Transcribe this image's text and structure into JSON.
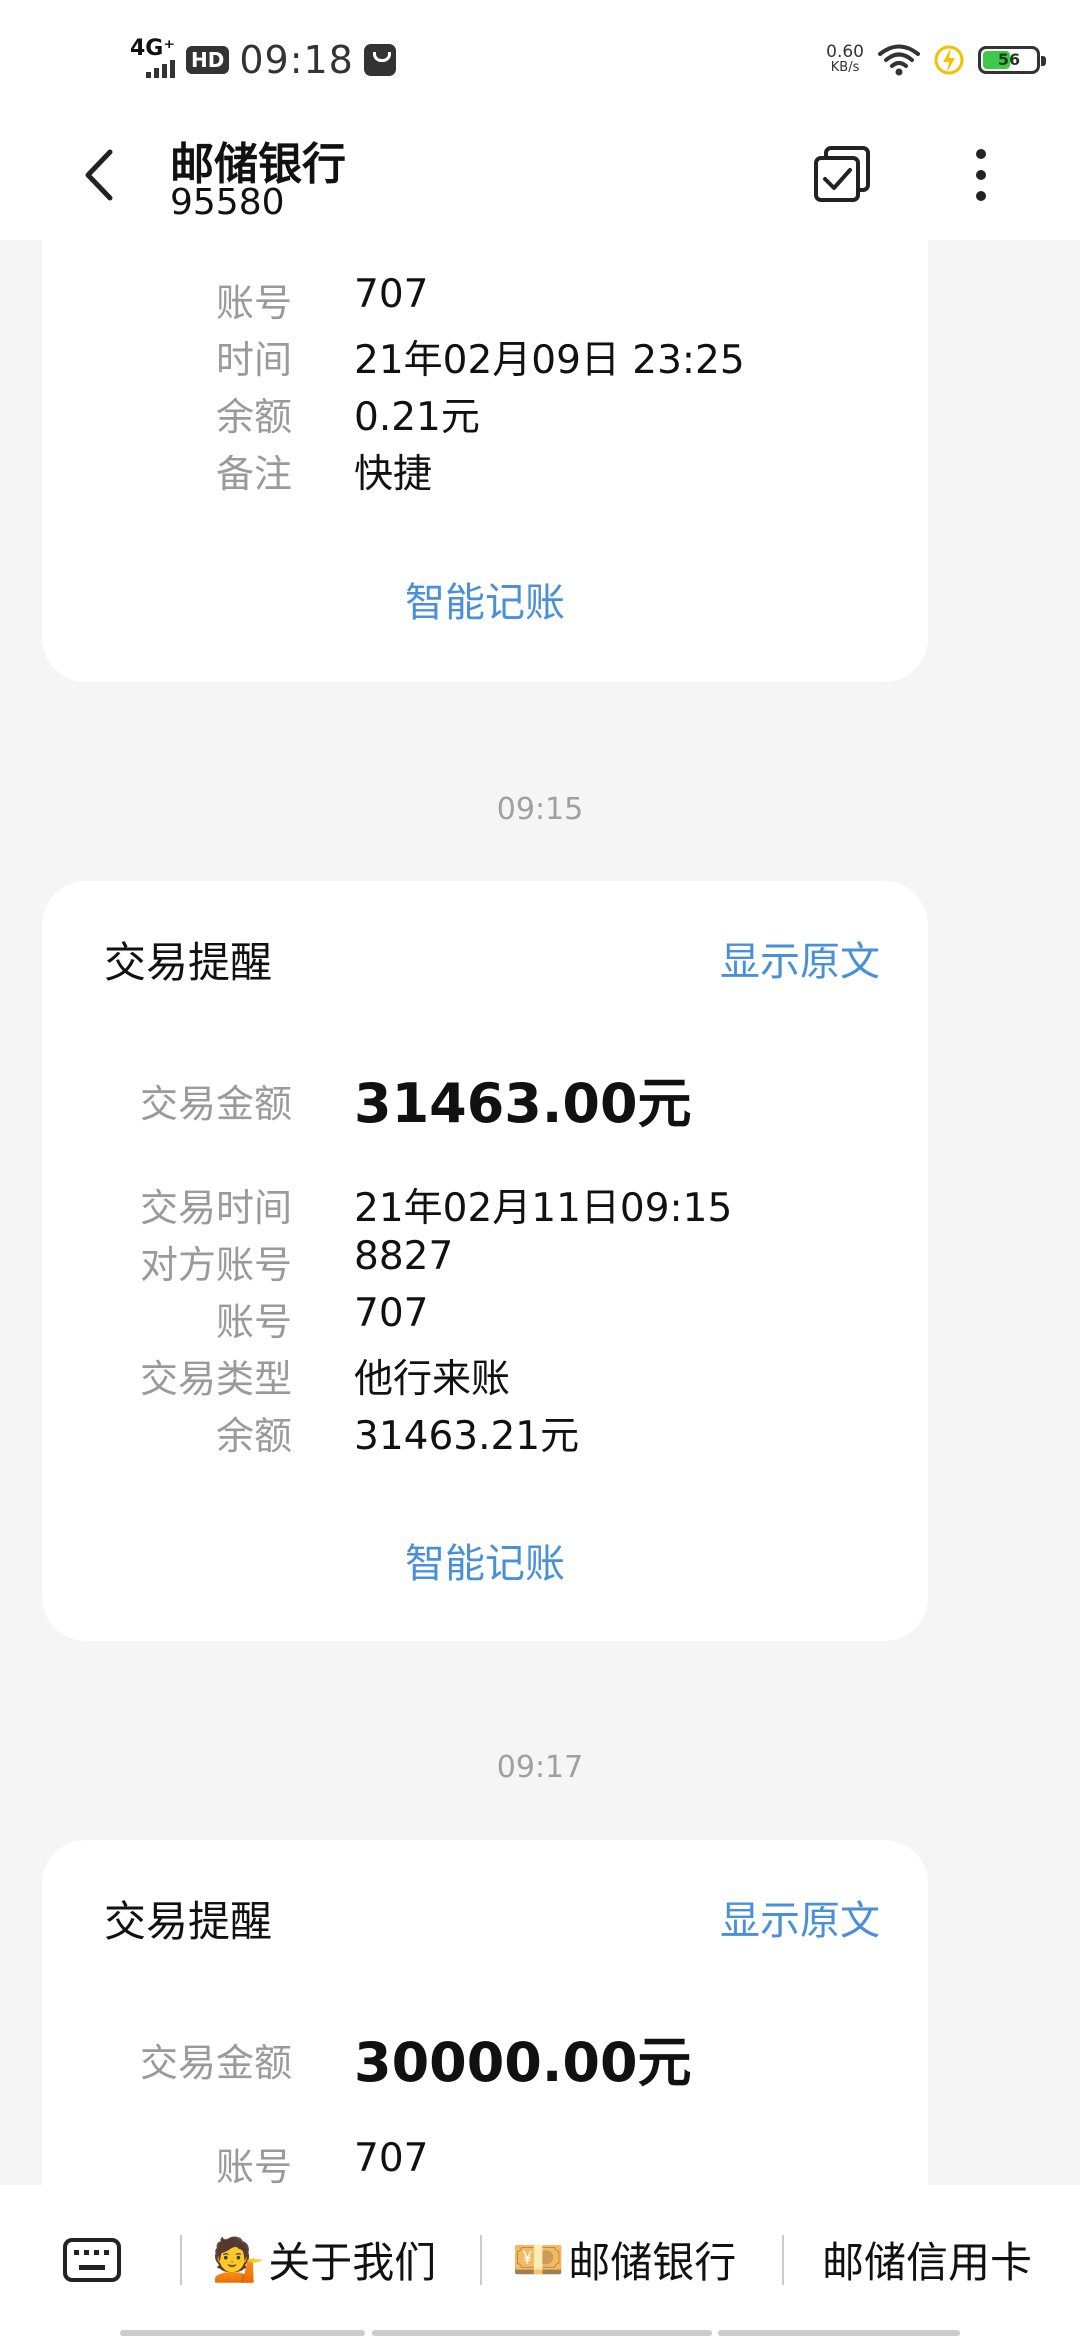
{
  "status_bar": {
    "network": "4G⁺",
    "hd": "HD",
    "time": "09:18",
    "speed_value": "0.60",
    "speed_unit": "KB/s",
    "battery": "56",
    "battery_level": 0.56
  },
  "header": {
    "title": "邮储银行",
    "subtitle": "95580"
  },
  "card0": {
    "rows": [
      {
        "key": "账号",
        "value": "707"
      },
      {
        "key": "时间",
        "value": "21年02月09日 23:25"
      },
      {
        "key": "余额",
        "value": "0.21元"
      },
      {
        "key": "备注",
        "value": "快捷"
      }
    ],
    "smart": "智能记账"
  },
  "card1": {
    "time": "09:15",
    "heading": "交易提醒",
    "show_original": "显示原文",
    "amount_label": "交易金额",
    "amount": "31463.00元",
    "rows": [
      {
        "key": "交易时间",
        "value": "21年02月11日09:15"
      },
      {
        "key": "对方账号",
        "value": "8827"
      },
      {
        "key": "账号",
        "value": "707"
      },
      {
        "key": "交易类型",
        "value": "他行来账"
      },
      {
        "key": "余额",
        "value": "31463.21元"
      }
    ],
    "smart": "智能记账"
  },
  "card2": {
    "time": "09:17",
    "heading": "交易提醒",
    "show_original": "显示原文",
    "amount_label": "交易金额",
    "amount": "30000.00元",
    "rows": [
      {
        "key": "账号",
        "value": "707"
      }
    ]
  },
  "bottom_menu": [
    {
      "label": "关于我们",
      "emoji": "💁"
    },
    {
      "label": "邮储银行",
      "emoji": "💴"
    },
    {
      "label": "邮储信用卡"
    }
  ]
}
